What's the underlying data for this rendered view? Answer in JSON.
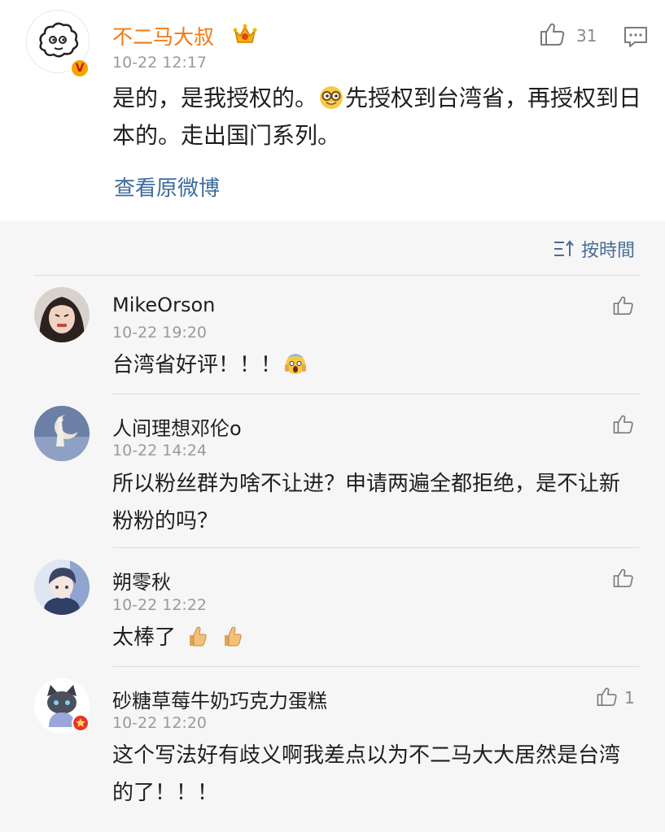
{
  "post": {
    "author": "不二马大叔",
    "time": "10-22 12:17",
    "like_count": "31",
    "text_before_emoji": "是的，是我授权的。",
    "text_after_emoji": "先授权到台湾省，再授权到日本的。走出国门系列。",
    "view_original": "查看原微博",
    "author_color": "#f07a14",
    "link_color": "#3e6a9a"
  },
  "sort": {
    "label": "按時間"
  },
  "comments": [
    {
      "name": "MikeOrson",
      "time": "10-22 19:20",
      "text": "台湾省好评！！！",
      "emoji": "scream-emoji",
      "like_count": ""
    },
    {
      "name": "人间理想邓伦o",
      "time": "10-22 14:24",
      "text": "所以粉丝群为啥不让进？申请两遍全都拒绝，是不让新粉粉的吗？",
      "like_count": ""
    },
    {
      "name": "朔零秋",
      "time": "10-22 12:22",
      "text": "太棒了",
      "emoji": "thumbs-up-emoji",
      "like_count": ""
    },
    {
      "name": "砂糖草莓牛奶巧克力蛋糕",
      "time": "10-22 12:20",
      "text": "这个写法好有歧义啊我差点以为不二马大大居然是台湾的了！！！",
      "like_count": "1"
    }
  ]
}
